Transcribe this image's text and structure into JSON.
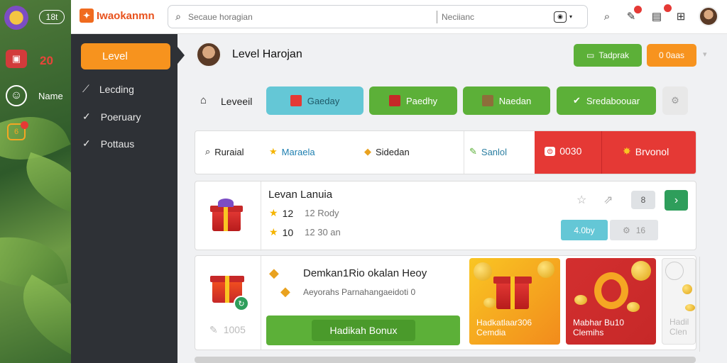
{
  "rail": {
    "time": "18t",
    "count": "20",
    "name": "Name"
  },
  "app": {
    "brand": "Iwaokanmn"
  },
  "search": {
    "placeholder": "Secaue horagian",
    "secondary": "Neciianc"
  },
  "sidebar": {
    "active": "Level",
    "items": [
      "Lecding",
      "Poeruary",
      "Pottaus"
    ]
  },
  "header": {
    "title": "Level Harojan",
    "btn_primary": "Tadprak",
    "btn_secondary": "0 0aas"
  },
  "levelbar": {
    "label": "Leveeil",
    "chips": [
      "Gaeday",
      "Paedhy",
      "Naedan",
      "Sredaboouar"
    ]
  },
  "tabs": {
    "items": [
      "Ruraial",
      "Maraela",
      "Sidedan",
      "Sanlol"
    ],
    "promo_a": "0030",
    "promo_b": "Brvonol"
  },
  "reward": {
    "title": "Levan Lanuia",
    "row1_num": "12",
    "row1_text": "12 Rody",
    "row2_num": "10",
    "row2_text": "12 30 an",
    "mini_badge": "8",
    "chip_label": "4.0by",
    "chip_value": "16"
  },
  "bonus": {
    "title": "Demkan1Rio okalan Heoy",
    "subtitle": "Aeyorahs Parnahangaeidoti 0",
    "counter": "1005",
    "cta": "Hadikah Bonux",
    "tiles": [
      {
        "label1": "Hadkatlaar306",
        "label2": "Cemdia"
      },
      {
        "label1": "Mabhar Bu10",
        "label2": "Clemihs"
      },
      {
        "label1": "Hadil",
        "label2": "Clen"
      }
    ]
  },
  "colors": {
    "orange": "#f7931e",
    "green": "#5cb038",
    "teal": "#64c7d6",
    "red": "#e53935",
    "sidebar": "#2e3136"
  }
}
